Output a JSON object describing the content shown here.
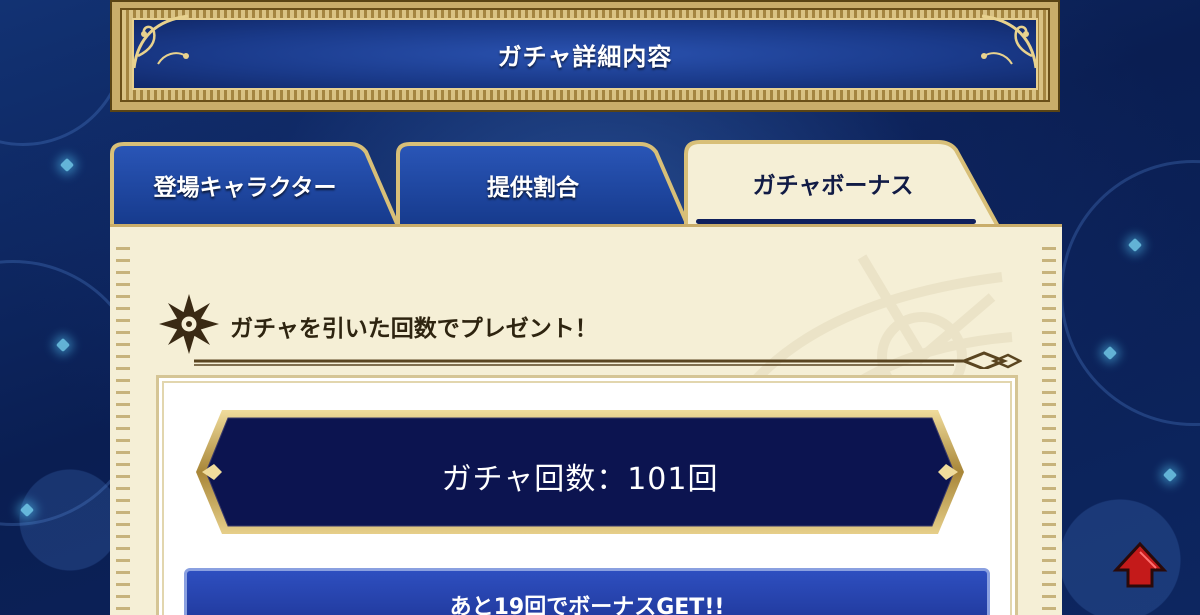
{
  "header": {
    "title": "ガチャ詳細内容"
  },
  "tabs": [
    {
      "label": "登場キャラクター",
      "active": false
    },
    {
      "label": "提供割合",
      "active": false
    },
    {
      "label": "ガチャボーナス",
      "active": true
    }
  ],
  "bonus": {
    "section_title": "ガチャを引いた回数でプレゼント！",
    "count_label": "ガチャ回数：101回",
    "next_label": "あと19回でボーナスGET!!"
  },
  "colors": {
    "accent_gold": "#c9ad6a",
    "navy_banner": "#0c1450",
    "parchment": "#f5efd6"
  },
  "icons": {
    "section_icon": "snowflake-emblem-icon",
    "scroll_button": "scroll-up-arrow-icon"
  }
}
